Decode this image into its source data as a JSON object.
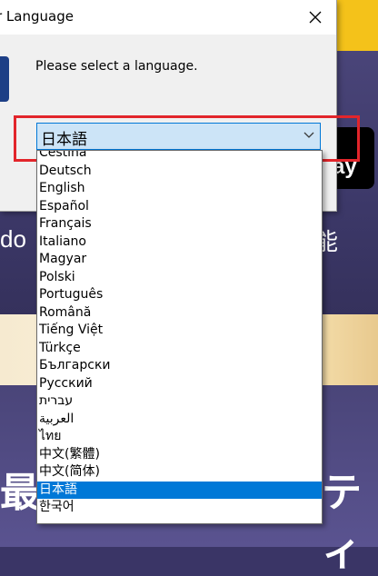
{
  "background": {
    "store_badge_text": "ay",
    "left_text": "do",
    "right_text": "能",
    "bottom_left_text": "最",
    "bottom_right_text": "ティ"
  },
  "dialog": {
    "title": "r Language",
    "prompt": "Please select a language.",
    "selected_language": "日本語",
    "close_icon": "close-icon",
    "dropdown_icon": "chevron-down-icon",
    "highlight_color": "#e2252b",
    "accent_color": "#0078d7"
  },
  "languages": [
    "Čeština",
    "Deutsch",
    "English",
    "Español",
    "Français",
    "Italiano",
    "Magyar",
    "Polski",
    "Português",
    "Română",
    "Tiếng Việt",
    "Türkçe",
    "Български",
    "Русский",
    "עברית",
    "العربية",
    "ไทย",
    "中文(繁體)",
    "中文(简体)",
    "日本語",
    "한국어"
  ],
  "selected_index": 19
}
